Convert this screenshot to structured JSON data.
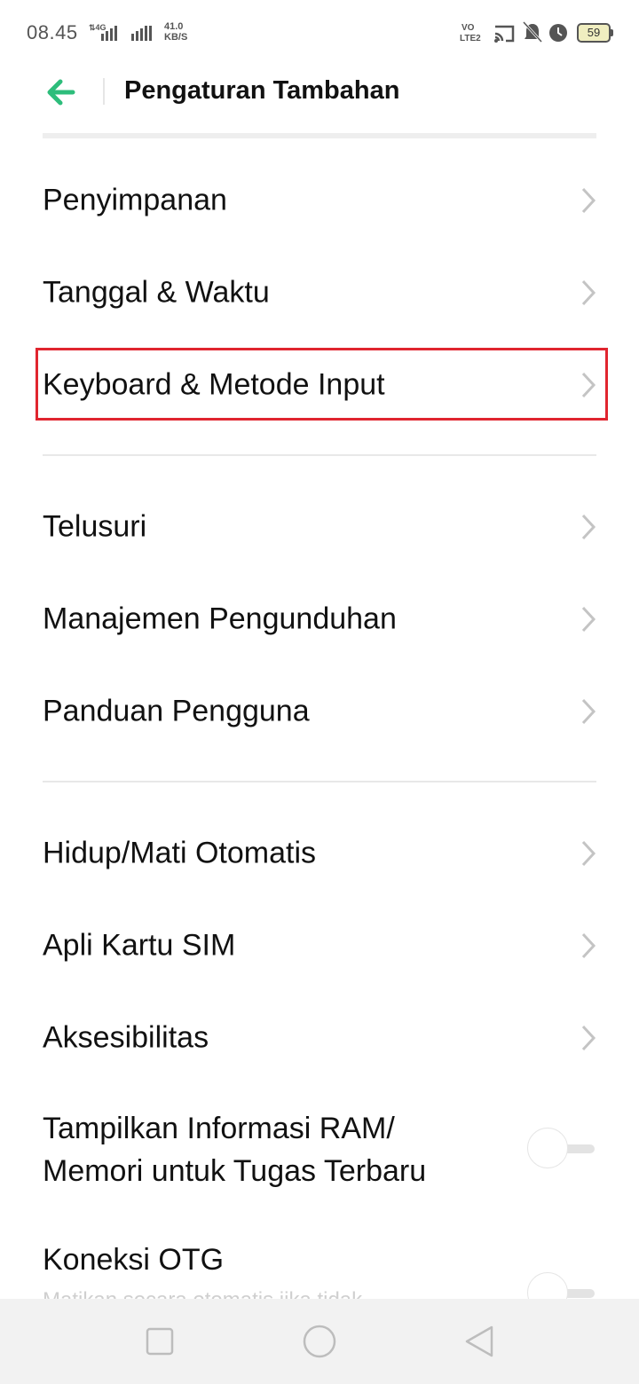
{
  "status_bar": {
    "time": "08.45",
    "network": "4G",
    "speed_value": "41.0",
    "speed_unit": "KB/S",
    "volte": "VO LTE2",
    "battery": "59"
  },
  "header": {
    "title": "Pengaturan Tambahan",
    "back_icon": "arrow-left-icon"
  },
  "section1": [
    {
      "label": "Penyimpanan"
    },
    {
      "label": "Tanggal & Waktu"
    },
    {
      "label": "Keyboard & Metode Input"
    }
  ],
  "section2": [
    {
      "label": "Telusuri"
    },
    {
      "label": "Manajemen Pengunduhan"
    },
    {
      "label": "Panduan Pengguna"
    }
  ],
  "section3": [
    {
      "label": "Hidup/Mati Otomatis"
    },
    {
      "label": "Apli Kartu SIM"
    },
    {
      "label": "Aksesibilitas"
    }
  ],
  "toggles": {
    "ram_info": {
      "label_line1": "Tampilkan Informasi RAM/",
      "label_line2": "Memori untuk Tugas Terbaru",
      "on": false
    },
    "otg": {
      "label": "Koneksi OTG",
      "subtext": "Matikan secara otomatis jika tidak",
      "on": false
    }
  },
  "colors": {
    "accent": "#2dbd7b",
    "highlight": "#e0252f"
  },
  "nav_icons": [
    "recent-apps-icon",
    "home-icon",
    "back-icon"
  ]
}
